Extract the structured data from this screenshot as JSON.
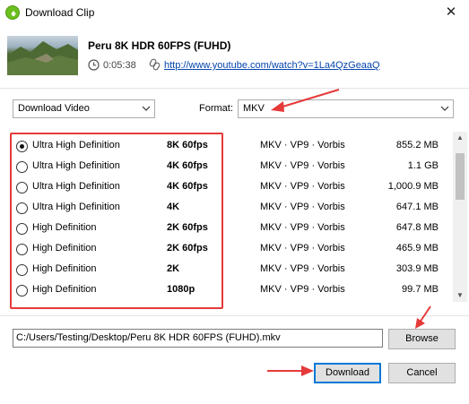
{
  "window": {
    "title": "Download Clip",
    "close_glyph": "✕"
  },
  "clip": {
    "title": "Peru 8K HDR 60FPS (FUHD)",
    "duration": "0:05:38",
    "url": "http://www.youtube.com/watch?v=1La4QzGeaaQ"
  },
  "options": {
    "download_type": "Download Video",
    "format_label": "Format:",
    "format_value": "MKV"
  },
  "formats": [
    {
      "quality": "Ultra High Definition",
      "resolution": "8K 60fps",
      "codec": "MKV · VP9 · Vorbis",
      "size": "855.2 MB",
      "selected": true
    },
    {
      "quality": "Ultra High Definition",
      "resolution": "4K 60fps",
      "codec": "MKV · VP9 · Vorbis",
      "size": "1.1 GB",
      "selected": false
    },
    {
      "quality": "Ultra High Definition",
      "resolution": "4K 60fps",
      "codec": "MKV · VP9 · Vorbis",
      "size": "1,000.9 MB",
      "selected": false
    },
    {
      "quality": "Ultra High Definition",
      "resolution": "4K",
      "codec": "MKV · VP9 · Vorbis",
      "size": "647.1 MB",
      "selected": false
    },
    {
      "quality": "High Definition",
      "resolution": "2K 60fps",
      "codec": "MKV · VP9 · Vorbis",
      "size": "647.8 MB",
      "selected": false
    },
    {
      "quality": "High Definition",
      "resolution": "2K 60fps",
      "codec": "MKV · VP9 · Vorbis",
      "size": "465.9 MB",
      "selected": false
    },
    {
      "quality": "High Definition",
      "resolution": "2K",
      "codec": "MKV · VP9 · Vorbis",
      "size": "303.9 MB",
      "selected": false
    },
    {
      "quality": "High Definition",
      "resolution": "1080p",
      "codec": "MKV · VP9 · Vorbis",
      "size": "99.7 MB",
      "selected": false
    }
  ],
  "save": {
    "path": "C:/Users/Testing/Desktop/Peru 8K HDR 60FPS (FUHD).mkv",
    "browse_label": "Browse"
  },
  "actions": {
    "download_label": "Download",
    "cancel_label": "Cancel"
  },
  "icons": {
    "app": "app-logo-icon",
    "clock": "clock-icon",
    "link": "link-icon",
    "dropdown": "chevron-down-icon"
  },
  "colors": {
    "annotation_red": "#e53a3a",
    "link_blue": "#0645ad",
    "focus_blue": "#0078d7"
  }
}
